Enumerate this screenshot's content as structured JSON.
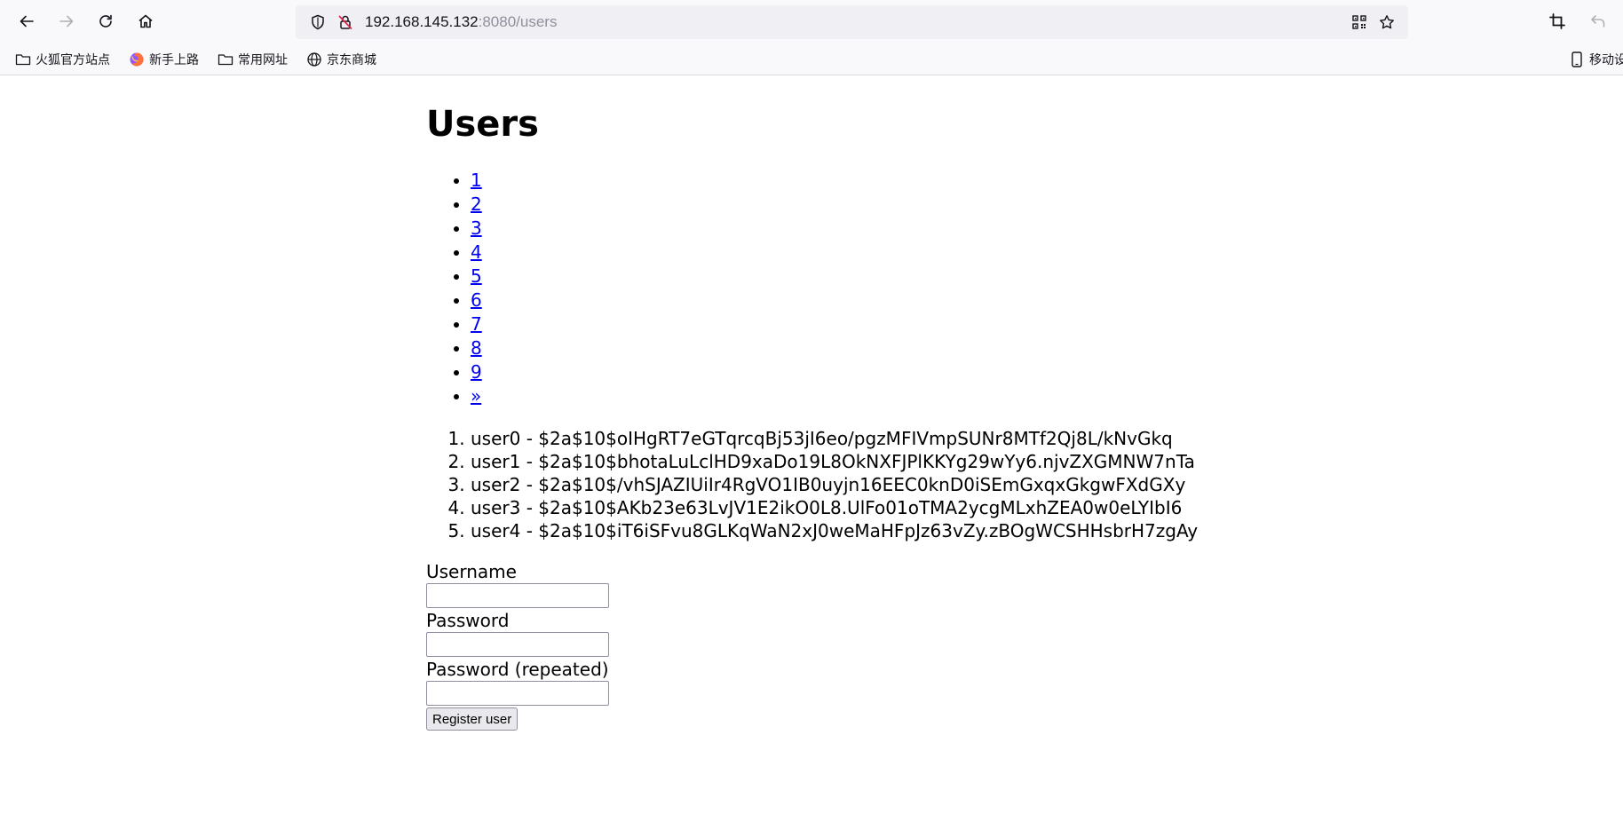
{
  "browser": {
    "url_host": "192.168.145.132",
    "url_path": ":8080/users",
    "bookmarks": [
      {
        "label": "火狐官方站点",
        "icon": "folder-icon"
      },
      {
        "label": "新手上路",
        "icon": "firefox-icon"
      },
      {
        "label": "常用网址",
        "icon": "folder-icon"
      },
      {
        "label": "京东商城",
        "icon": "globe-icon"
      }
    ],
    "mobile_bookmarks": "移动设"
  },
  "page": {
    "title": "Users",
    "pagination": [
      "1",
      "2",
      "3",
      "4",
      "5",
      "6",
      "7",
      "8",
      "9",
      "»"
    ],
    "users": [
      "user0 - $2a$10$oIHgRT7eGTqrcqBj53jI6eo/pgzMFIVmpSUNr8MTf2Qj8L/kNvGkq",
      "user1 - $2a$10$bhotaLuLclHD9xaDo19L8OkNXFJPlKKYg29wYy6.njvZXGMNW7nTa",
      "user2 - $2a$10$/vhSJAZIUiIr4RgVO1IB0uyjn16EEC0knD0iSEmGxqxGkgwFXdGXy",
      "user3 - $2a$10$AKb23e63LvJV1E2ikO0L8.UlFo01oTMA2ycgMLxhZEA0w0eLYIbI6",
      "user4 - $2a$10$iT6iSFvu8GLKqWaN2xJ0weMaHFpJz63vZy.zBOgWCSHHsbrH7zgAy"
    ],
    "form": {
      "username_label": "Username",
      "username_value": "",
      "password_label": "Password",
      "password_value": "",
      "password_repeat_label": "Password (repeated)",
      "password_repeat_value": "",
      "submit_label": "Register user"
    }
  }
}
